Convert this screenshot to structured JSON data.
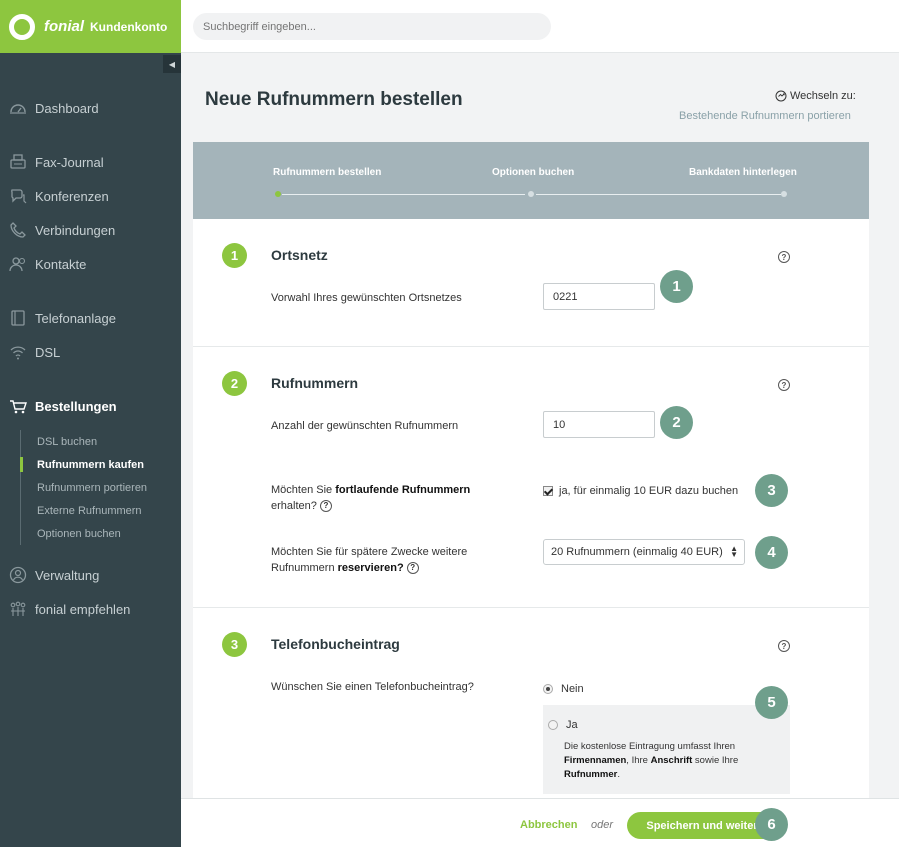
{
  "brand": {
    "name": "fonial",
    "product": "Kundenkonto"
  },
  "search": {
    "placeholder": "Suchbegriff eingeben..."
  },
  "sidebar": {
    "items": [
      {
        "label": "Dashboard",
        "icon": "speedometer-icon"
      },
      {
        "label": "Fax-Journal",
        "icon": "fax-icon"
      },
      {
        "label": "Konferenzen",
        "icon": "conference-icon"
      },
      {
        "label": "Verbindungen",
        "icon": "phone-icon"
      },
      {
        "label": "Kontakte",
        "icon": "contacts-icon"
      },
      {
        "label": "Telefonanlage",
        "icon": "phone-system-icon"
      },
      {
        "label": "DSL",
        "icon": "wifi-icon"
      },
      {
        "label": "Bestellungen",
        "icon": "cart-icon"
      },
      {
        "label": "Verwaltung",
        "icon": "user-icon"
      },
      {
        "label": "fonial empfehlen",
        "icon": "people-icon"
      }
    ],
    "sub_items": [
      {
        "label": "DSL buchen"
      },
      {
        "label": "Rufnummern kaufen"
      },
      {
        "label": "Rufnummern portieren"
      },
      {
        "label": "Externe Rufnummern"
      },
      {
        "label": "Optionen buchen"
      }
    ],
    "active": "Bestellungen",
    "active_sub": "Rufnummern kaufen"
  },
  "page": {
    "title": "Neue Rufnummern bestellen",
    "switch_label": "Wechseln zu:",
    "switch_link": "Bestehende Rufnummern portieren"
  },
  "steps": [
    {
      "label": "Rufnummern bestellen"
    },
    {
      "label": "Optionen buchen"
    },
    {
      "label": "Bankdaten hinterlegen"
    }
  ],
  "sections": {
    "ortsnetz": {
      "number": "1",
      "title": "Ortsnetz",
      "field_label": "Vorwahl Ihres gewünschten Ortsnetzes",
      "value": "0221"
    },
    "rufnummern": {
      "number": "2",
      "title": "Rufnummern",
      "count_label": "Anzahl der gewünschten Rufnummern",
      "count_value": "10",
      "consecutive_label_pre": "Möchten Sie ",
      "consecutive_label_bold": "fortlaufende Rufnummern",
      "consecutive_label_post": "erhalten?",
      "consecutive_checkbox": "ja, für einmalig 10 EUR dazu buchen",
      "reserve_label_pre": "Möchten Sie für spätere Zwecke weitere",
      "reserve_label_mid": "Rufnummern ",
      "reserve_label_bold": "reservieren?",
      "reserve_select": "20 Rufnummern (einmalig 40 EUR)"
    },
    "telefonbuch": {
      "number": "3",
      "title": "Telefonbucheintrag",
      "question": "Wünschen Sie einen Telefonbucheintrag?",
      "option_no": "Nein",
      "option_yes": "Ja",
      "desc_1": "Die kostenlose Eintragung umfasst Ihren",
      "desc_b1": "Firmennamen",
      "desc_2": ", Ihre ",
      "desc_b2": "Anschrift",
      "desc_3": " sowie Ihre",
      "desc_b3": "Rufnummer",
      "desc_4": "."
    }
  },
  "help_symbol": "?",
  "badges": [
    "1",
    "2",
    "3",
    "4",
    "5",
    "6"
  ],
  "footer": {
    "cancel": "Abbrechen",
    "or": "oder",
    "save": "Speichern und weiter"
  },
  "colors": {
    "accent": "#8dc63f",
    "sidebar": "#34454b",
    "badge": "#6f9f8c",
    "steps_bar": "#a4b4ba"
  }
}
